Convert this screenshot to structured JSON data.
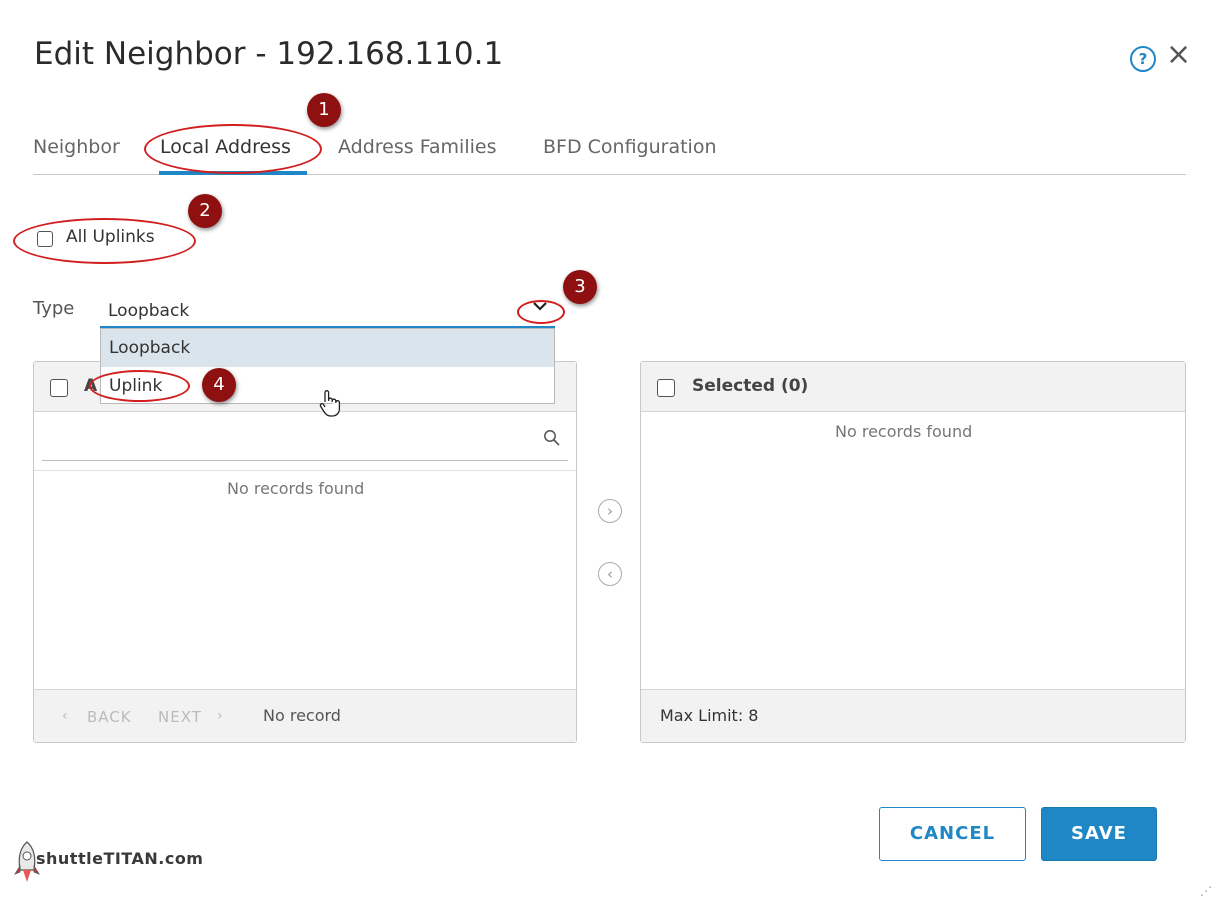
{
  "dialog": {
    "title": "Edit Neighbor - 192.168.110.1"
  },
  "tabs": [
    {
      "label": "Neighbor"
    },
    {
      "label": "Local Address"
    },
    {
      "label": "Address Families"
    },
    {
      "label": "BFD Configuration"
    }
  ],
  "all_uplinks": {
    "label": "All Uplinks",
    "checked": false
  },
  "type": {
    "label": "Type",
    "value": "Loopback",
    "options": [
      "Loopback",
      "Uplink"
    ]
  },
  "available_panel": {
    "header_partial": "A",
    "empty_text": "No records found",
    "back_label": "BACK",
    "next_label": "NEXT",
    "record_status": "No record"
  },
  "selected_panel": {
    "header": "Selected (0)",
    "empty_text": "No records found",
    "max_limit": "Max Limit: 8"
  },
  "buttons": {
    "cancel": "CANCEL",
    "save": "SAVE"
  },
  "annotations": [
    "1",
    "2",
    "3",
    "4"
  ],
  "watermark": "shuttleTITAN.com",
  "colors": {
    "accent": "#1f87c5",
    "annotation": "#8e1010",
    "oval": "#d11f1f"
  }
}
